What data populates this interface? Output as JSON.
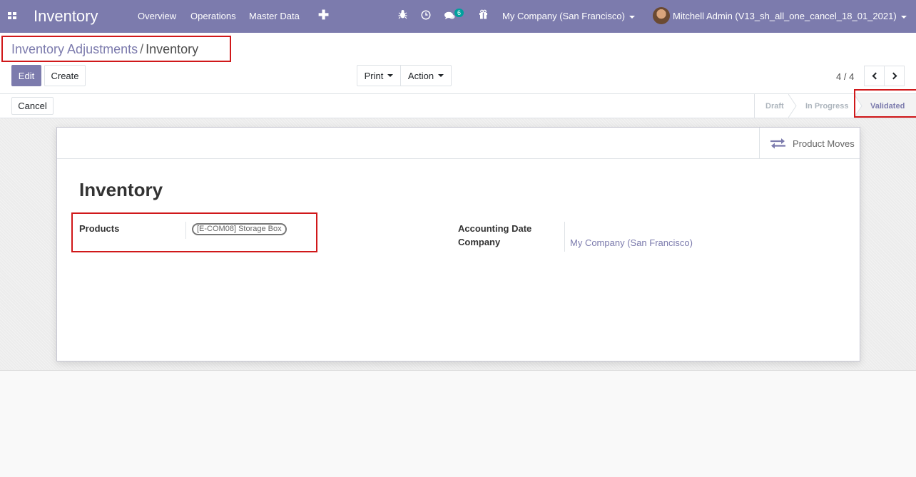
{
  "navbar": {
    "app_title": "Inventory",
    "menu": [
      "Overview",
      "Operations",
      "Master Data"
    ],
    "chat_badge": "6",
    "company": "My Company (San Francisco)",
    "user": "Mitchell Admin (V13_sh_all_one_cancel_18_01_2021)",
    "icons": [
      "apps-icon",
      "plus-icon",
      "bug-icon",
      "clock-icon",
      "chat-icon",
      "gift-icon"
    ]
  },
  "breadcrumb": {
    "parent": "Inventory Adjustments",
    "separator": "/",
    "current": "Inventory"
  },
  "toolbar": {
    "edit": "Edit",
    "create": "Create",
    "print": "Print",
    "action": "Action"
  },
  "pager": {
    "value": "4 / 4"
  },
  "statusbar": {
    "cancel": "Cancel",
    "steps": [
      "Draft",
      "In Progress",
      "Validated"
    ],
    "active_step": "Validated"
  },
  "sheet": {
    "smart_button": "Product Moves",
    "title": "Inventory",
    "products_label": "Products",
    "product_tag": "[E-COM08] Storage Box",
    "accounting_date_label": "Accounting Date",
    "company_label": "Company",
    "company_value": "My Company (San Francisco)"
  },
  "colors": {
    "brand": "#7c7bad",
    "highlight": "#d0181a",
    "badge": "#00a09d"
  }
}
